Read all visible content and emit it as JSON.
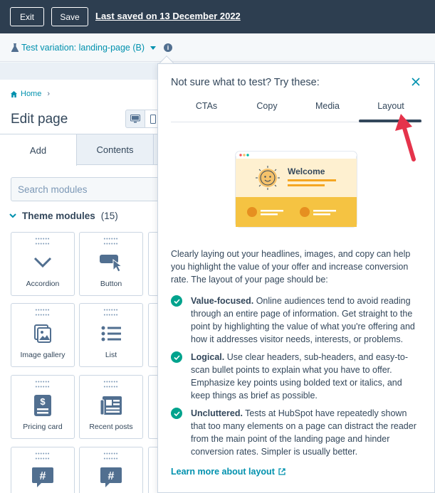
{
  "topbar": {
    "exit_label": "Exit",
    "save_label": "Save",
    "last_saved": "Last saved on 13 December 2022"
  },
  "variation": {
    "label": "Test variation: landing-page (B)"
  },
  "left": {
    "breadcrumb_home": "Home",
    "title": "Edit page",
    "tab_add": "Add",
    "tab_contents": "Contents",
    "search_placeholder": "Search modules",
    "theme_modules_label": "Theme modules",
    "theme_modules_count": "(15)",
    "modules": [
      {
        "label": "Accordion",
        "icon": "chevron-down-icon"
      },
      {
        "label": "Button",
        "icon": "button-cursor-icon"
      },
      {
        "label": "Image gallery",
        "icon": "image-gallery-icon"
      },
      {
        "label": "List",
        "icon": "list-icon"
      },
      {
        "label": "Pricing card",
        "icon": "pricing-card-icon"
      },
      {
        "label": "Recent posts",
        "icon": "recent-posts-icon"
      },
      {
        "label": "",
        "icon": "hashtag-icon"
      },
      {
        "label": "",
        "icon": "hashtag-icon"
      }
    ]
  },
  "popover": {
    "title": "Not sure what to test? Try these:",
    "tabs": [
      "CTAs",
      "Copy",
      "Media",
      "Layout"
    ],
    "active_tab": "Layout",
    "illustration_text": "Welcome",
    "intro": "Clearly laying out your headlines, images, and copy can help you highlight the value of your offer and increase conversion rate. The layout of your page should be:",
    "points": [
      {
        "heading": "Value-focused.",
        "body": " Online audiences tend to avoid reading through an entire page of information. Get straight to the point by highlighting the value of what you're offering and how it addresses visitor needs, interests, or problems."
      },
      {
        "heading": "Logical.",
        "body": " Use clear headers, sub-headers, and easy-to-scan bullet points to explain what you have to offer. Emphasize key points using bolded text or italics, and keep things as brief as possible."
      },
      {
        "heading": "Uncluttered.",
        "body": " Tests at HubSpot have repeatedly shown that too many elements on a page can distract the reader from the main point of the landing page and hinder conversion rates. Simpler is usually better."
      }
    ],
    "learn_more": "Learn more about layout"
  },
  "colors": {
    "topbar": "#2d3e50",
    "link": "#0091ae",
    "check": "#00a38d",
    "annotation_arrow": "#e5334b"
  }
}
